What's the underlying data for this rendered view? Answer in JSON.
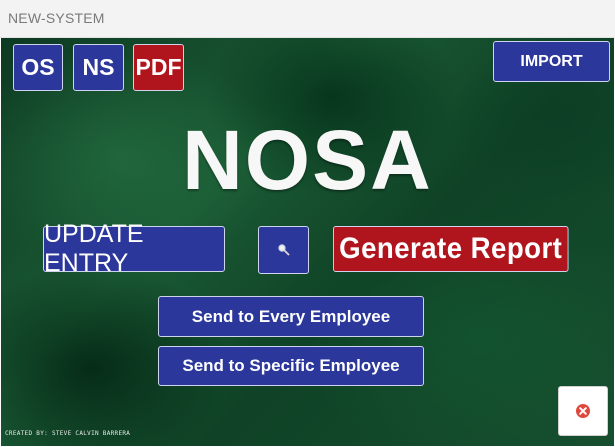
{
  "window": {
    "title": "NEW-SYSTEM"
  },
  "toolbar": {
    "os_label": "OS",
    "ns_label": "NS",
    "pdf_label": "PDF",
    "import_label": "IMPORT"
  },
  "main": {
    "heading": "NOSA",
    "update_entry_label": "UPDATE ENTRY",
    "search_icon": "search-icon",
    "generate_report_label": "Generate Report",
    "send_every_label": "Send to Every Employee",
    "send_specific_label": "Send to Specific Employee"
  },
  "footer": {
    "credit": "CREATED BY: STEVE CALVIN BARRERA",
    "close_icon": "close-icon"
  },
  "colors": {
    "button_blue": "#2b379b",
    "button_red": "#b0141c",
    "background_green": "#1a5a34",
    "close_red": "#e0483c"
  }
}
